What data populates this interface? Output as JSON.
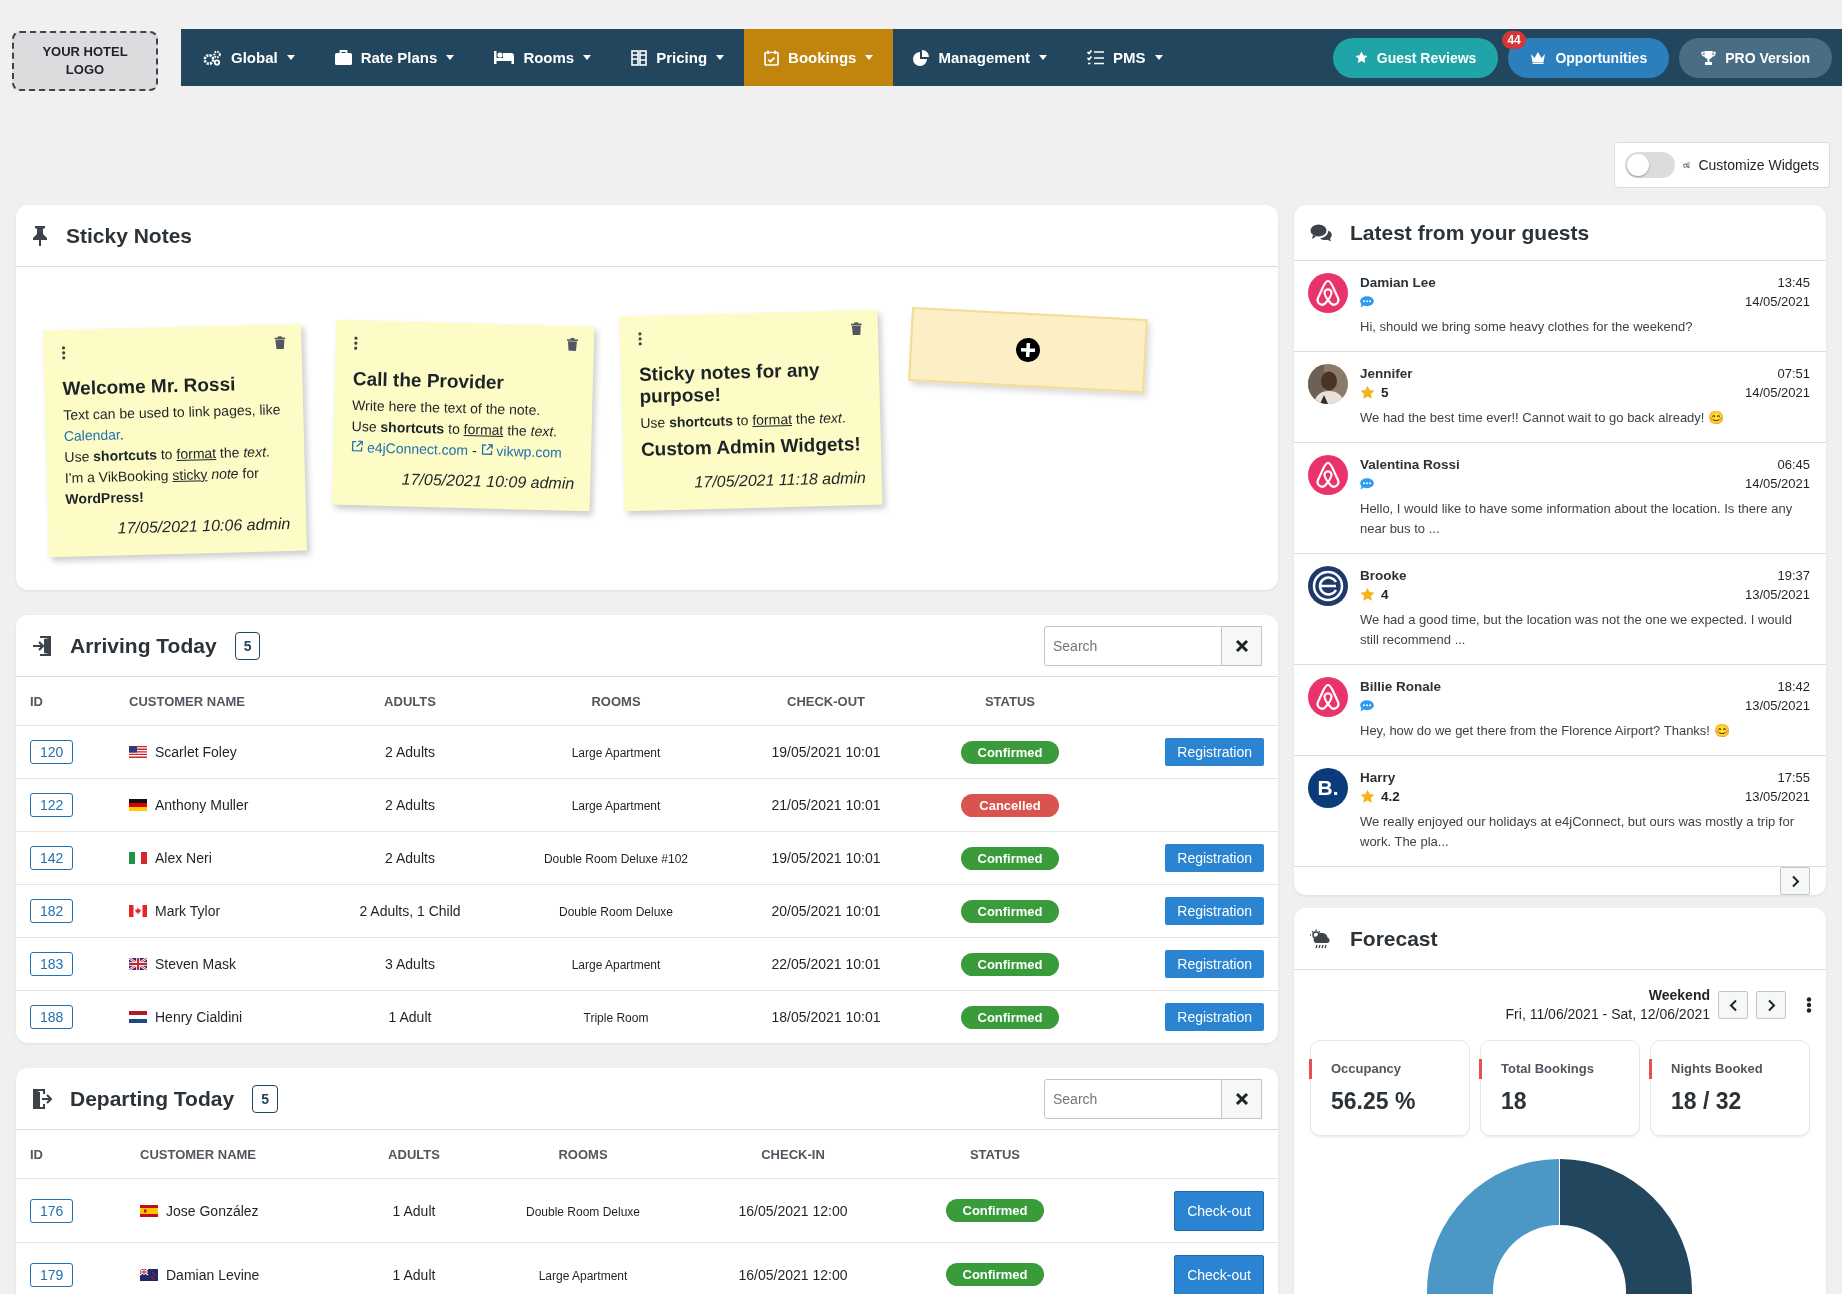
{
  "logo": "YOUR HOTEL LOGO",
  "nav": [
    {
      "label": "Global",
      "selected": false
    },
    {
      "label": "Rate Plans",
      "selected": false
    },
    {
      "label": "Rooms",
      "selected": false
    },
    {
      "label": "Pricing",
      "selected": false
    },
    {
      "label": "Bookings",
      "selected": true
    },
    {
      "label": "Management",
      "selected": false
    },
    {
      "label": "PMS",
      "selected": false
    }
  ],
  "actions": [
    {
      "label": "Guest Reviews",
      "color": "#1fa5a8"
    },
    {
      "label": "Opportunities",
      "color": "#2b7fbd",
      "badge": "44"
    },
    {
      "label": "PRO Version",
      "color": "#4a6d86"
    }
  ],
  "customize": {
    "label": "Customize Widgets",
    "on": false
  },
  "sticky_notes": {
    "title": "Sticky Notes",
    "notes": [
      {
        "title": "Welcome Mr. Rossi",
        "lines": [
          [
            {
              "text": "Text can be used to link pages, like"
            }
          ],
          [
            {
              "text": "Calendar",
              "kind": "link"
            },
            {
              "text": "."
            }
          ],
          [
            {
              "text": "Use "
            },
            {
              "text": "shortcuts",
              "kind": "bold"
            },
            {
              "text": " to "
            },
            {
              "text": "format",
              "kind": "underline"
            },
            {
              "text": " the "
            },
            {
              "text": "text",
              "kind": "italic"
            },
            {
              "text": "."
            }
          ],
          [
            {
              "text": "I'm a VikBooking "
            },
            {
              "text": "sticky",
              "kind": "underline"
            },
            {
              "text": " note",
              "kind": "italic"
            },
            {
              "text": " for"
            }
          ],
          [
            {
              "text": "WordPress!",
              "kind": "bold"
            }
          ]
        ],
        "date": "17/05/2021 10:06 admin"
      },
      {
        "title": "Call the Provider",
        "lines": [
          [
            {
              "text": "Write here the text of the note."
            }
          ],
          [
            {
              "text": "Use "
            },
            {
              "text": "shortcuts",
              "kind": "bold"
            },
            {
              "text": " to "
            },
            {
              "text": "format",
              "kind": "underline"
            },
            {
              "text": " the "
            },
            {
              "text": "text",
              "kind": "italic"
            },
            {
              "text": "."
            }
          ],
          [
            {
              "text": "e4jConnect.com",
              "kind": "extlink"
            },
            {
              "text": " - "
            },
            {
              "text": "vikwp.com",
              "kind": "extlink"
            }
          ]
        ],
        "date": "17/05/2021 10:09 admin"
      },
      {
        "title": "Sticky notes for any purpose!",
        "lines": [
          [
            {
              "text": "Use "
            },
            {
              "text": "shortcuts",
              "kind": "bold"
            },
            {
              "text": " to "
            },
            {
              "text": "format",
              "kind": "underline"
            },
            {
              "text": " the "
            },
            {
              "text": "text",
              "kind": "italic"
            },
            {
              "text": "."
            }
          ],
          [
            {
              "text": "Custom Admin Widgets!",
              "kind": "heading"
            }
          ]
        ],
        "date": "17/05/2021 11:18 admin"
      }
    ]
  },
  "tables": [
    {
      "title": "Arriving Today",
      "count": "5",
      "search": {
        "placeholder": "Search"
      },
      "columns": [
        "ID",
        "CUSTOMER NAME",
        "ADULTS",
        "ROOMS",
        "CHECK-OUT",
        "STATUS"
      ],
      "rows": [
        {
          "id": "120",
          "flag": {
            "kind": "us"
          },
          "name": "Scarlet Foley",
          "adults": "2 Adults",
          "room": "Large Apartment",
          "date": "19/05/2021 10:01",
          "status": {
            "kind": "confirmed",
            "label": "Confirmed"
          },
          "action": "Registration"
        },
        {
          "id": "122",
          "flag": {
            "kind": "de"
          },
          "name": "Anthony Muller",
          "adults": "2 Adults",
          "room": "Large Apartment",
          "date": "21/05/2021 10:01",
          "status": {
            "kind": "cancelled",
            "label": "Cancelled"
          }
        },
        {
          "id": "142",
          "flag": {
            "kind": "it"
          },
          "name": "Alex Neri",
          "adults": "2 Adults",
          "room": "Double Room Deluxe #102",
          "date": "19/05/2021 10:01",
          "status": {
            "kind": "confirmed",
            "label": "Confirmed"
          },
          "action": "Registration"
        },
        {
          "id": "182",
          "flag": {
            "kind": "ca"
          },
          "name": "Mark Tylor",
          "adults": "2 Adults, 1 Child",
          "room": "Double Room Deluxe",
          "date": "20/05/2021 10:01",
          "status": {
            "kind": "confirmed",
            "label": "Confirmed"
          },
          "action": "Registration"
        },
        {
          "id": "183",
          "flag": {
            "kind": "gb"
          },
          "name": "Steven Mask",
          "adults": "3 Adults",
          "room": "Large Apartment",
          "date": "22/05/2021 10:01",
          "status": {
            "kind": "confirmed",
            "label": "Confirmed"
          },
          "action": "Registration"
        },
        {
          "id": "188",
          "flag": {
            "kind": "nl"
          },
          "name": "Henry Cialdini",
          "adults": "1 Adult",
          "room": "Triple Room",
          "date": "18/05/2021 10:01",
          "status": {
            "kind": "confirmed",
            "label": "Confirmed"
          },
          "action": "Registration"
        }
      ]
    },
    {
      "title": "Departing Today",
      "count": "5",
      "search": {
        "placeholder": "Search"
      },
      "columns": [
        "ID",
        "CUSTOMER NAME",
        "ADULTS",
        "ROOMS",
        "CHECK-IN",
        "STATUS"
      ],
      "rows": [
        {
          "id": "176",
          "flag": {
            "kind": "es"
          },
          "name": "Jose González",
          "adults": "1 Adult",
          "room": "Double Room Deluxe",
          "date": "16/05/2021 12:00",
          "status": {
            "kind": "confirmed",
            "label": "Confirmed"
          },
          "action": "Check-out"
        },
        {
          "id": "179",
          "flag": {
            "kind": "nz"
          },
          "name": "Damian Levine",
          "adults": "1 Adult",
          "room": "Large Apartment",
          "date": "16/05/2021 12:00",
          "status": {
            "kind": "confirmed",
            "label": "Confirmed"
          },
          "action": "Check-out"
        }
      ]
    }
  ],
  "guests": {
    "title": "Latest from your guests",
    "messages": [
      {
        "avatar": {
          "kind": "loop"
        },
        "name": "Damian Lee",
        "kind": "message",
        "time": "13:45",
        "date": "14/05/2021",
        "text": "Hi, should we bring some heavy clothes for the weekend?"
      },
      {
        "name": "Jennifer",
        "kind": "review",
        "rating": "5",
        "time": "07:51",
        "date": "14/05/2021",
        "text": "We had the best time ever!! Cannot wait to go back already! 😊"
      },
      {
        "avatar": {
          "kind": "loop"
        },
        "name": "Valentina Rossi",
        "kind": "message",
        "time": "06:45",
        "date": "14/05/2021",
        "text": "Hello, I would like to have some information about the location. Is there any near bus to ..."
      },
      {
        "avatar": {
          "kind": "ring"
        },
        "name": "Brooke",
        "kind": "review",
        "rating": "4",
        "time": "19:37",
        "date": "13/05/2021",
        "text": "We had a good time, but the location was not the one we expected. I would still recommend ..."
      },
      {
        "avatar": {
          "kind": "loop"
        },
        "name": "Billie Ronale",
        "kind": "message",
        "time": "18:42",
        "date": "13/05/2021",
        "text": "Hey, how do we get there from the Florence Airport? Thanks! 😊"
      },
      {
        "avatar": {
          "kind": "letter",
          "text": "B."
        },
        "name": "Harry",
        "kind": "review",
        "rating": "4.2",
        "time": "17:55",
        "date": "13/05/2021",
        "text": "We really enjoyed our holidays at e4jConnect, but ours was mostly a trip for work. The pla..."
      }
    ]
  },
  "forecast": {
    "title": "Forecast",
    "period": "Weekend",
    "range": "Fri, 11/06/2021 - Sat, 12/06/2021",
    "stats": [
      {
        "label": "Occupancy",
        "value": "56.25 %"
      },
      {
        "label": "Total Bookings",
        "value": "18"
      },
      {
        "label": "Nights Booked",
        "value": "18 / 32"
      }
    ]
  }
}
